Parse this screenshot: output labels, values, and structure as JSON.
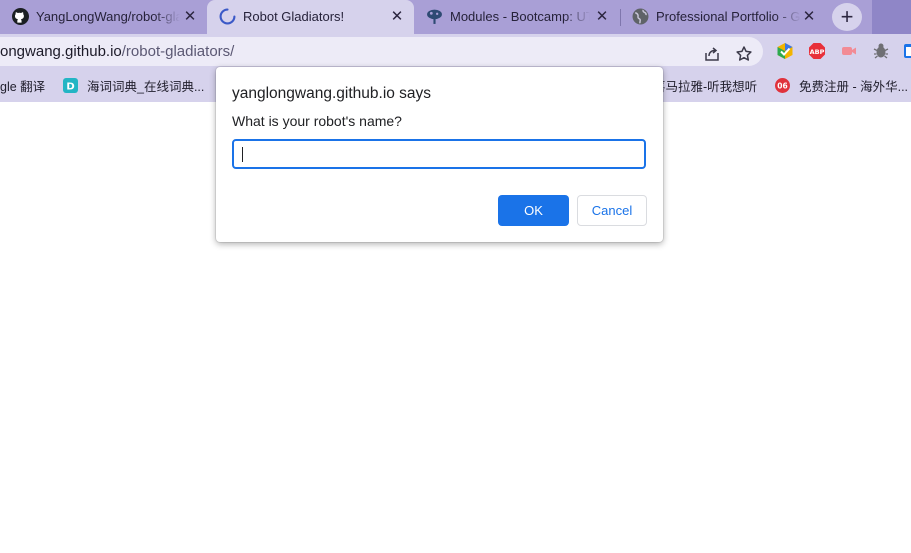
{
  "tabs": [
    {
      "title": "YangLongWang/robot-gladiators",
      "icon": "github-icon",
      "close": "✕"
    },
    {
      "title": "Robot Gladiators!",
      "icon": "loading-spinner-icon",
      "close": "✕"
    },
    {
      "title": "Modules - Bootcamp: UT",
      "icon": "bootcamp-tree-icon",
      "close": "✕"
    },
    {
      "title": "Professional Portfolio - Google",
      "icon": "globe-icon",
      "close": "✕"
    }
  ],
  "new_tab_label": "+",
  "omnibox": {
    "host": "ongwang.github.io",
    "path": "/robot-gladiators/"
  },
  "toolbar_icons": [
    "share-icon",
    "star-icon",
    "extension-colorful-icon",
    "adblock-plus-icon",
    "record-icon",
    "bug-extension-icon"
  ],
  "bookmarks": [
    {
      "label": "gle 翻译",
      "icon": ""
    },
    {
      "label": "海词词典_在线词典...",
      "icon": "haici-icon"
    },
    {
      "label": "喜马拉雅-听我想听",
      "icon": ""
    },
    {
      "label": "免费注册 - 海外华...",
      "icon": "06-icon"
    }
  ],
  "dialog": {
    "origin": "yanglongwang.github.io says",
    "message": "What is your robot's name?",
    "input_value": "",
    "ok_label": "OK",
    "cancel_label": "Cancel"
  },
  "colors": {
    "tab_strip": "#a99fd6",
    "toolbar": "#d6d2ec",
    "accent": "#1a73e8"
  }
}
